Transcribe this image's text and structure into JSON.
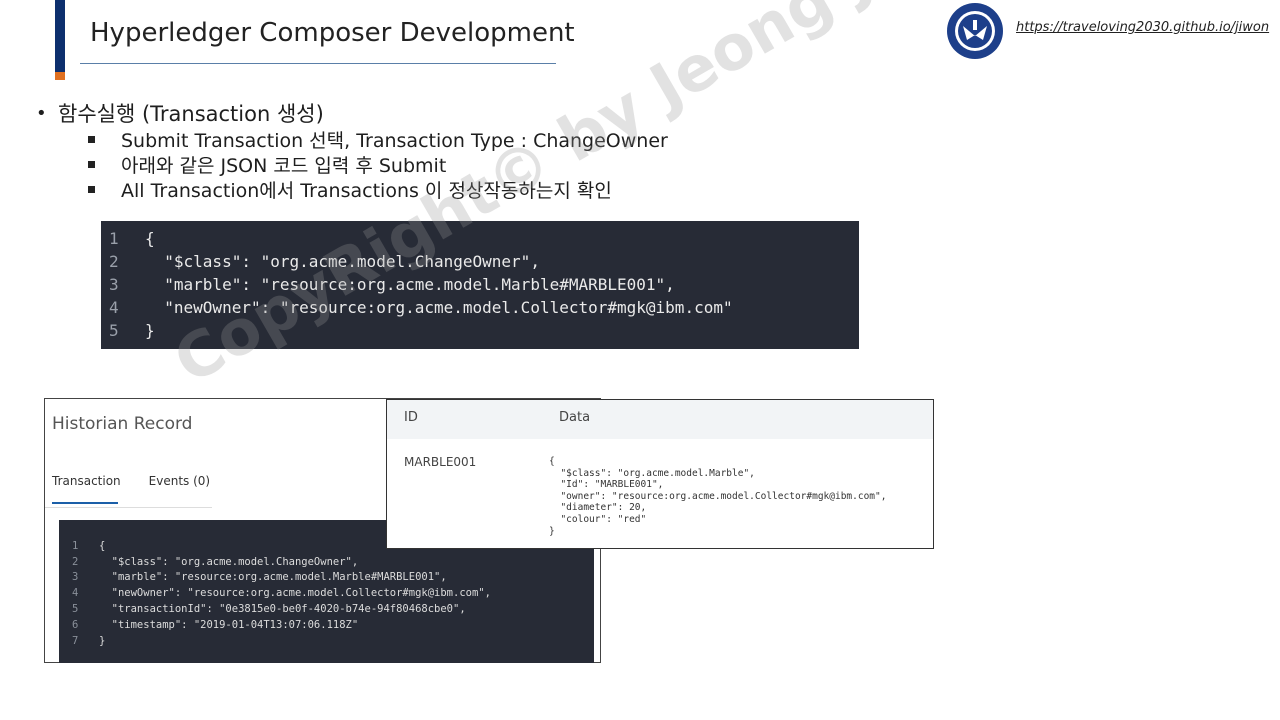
{
  "header": {
    "title": "Hyperledger Composer Development",
    "site_link": "https://traveloving2030.github.io/jiwon",
    "colors": {
      "accent_blue": "#0d2f6e",
      "accent_orange": "#e07020"
    }
  },
  "content": {
    "main_bullet": "함수실행 (Transaction 생성)",
    "sub_bullets": [
      "Submit Transaction 선택, Transaction Type : ChangeOwner",
      "아래와 같은 JSON 코드 입력 후 Submit",
      "All Transaction에서 Transactions 이 정상작동하는지 확인"
    ],
    "code_block": [
      {
        "num": "1",
        "text": "{"
      },
      {
        "num": "2",
        "text": "  \"$class\": \"org.acme.model.ChangeOwner\","
      },
      {
        "num": "3",
        "text": "  \"marble\": \"resource:org.acme.model.Marble#MARBLE001\","
      },
      {
        "num": "4",
        "text": "  \"newOwner\": \"resource:org.acme.model.Collector#mgk@ibm.com\""
      },
      {
        "num": "5",
        "text": "}"
      }
    ]
  },
  "historian": {
    "title": "Historian Record",
    "tabs": [
      "Transaction",
      "Events (0)"
    ],
    "code": [
      {
        "num": "1",
        "text": "{"
      },
      {
        "num": "2",
        "text": "  \"$class\": \"org.acme.model.ChangeOwner\","
      },
      {
        "num": "3",
        "text": "  \"marble\": \"resource:org.acme.model.Marble#MARBLE001\","
      },
      {
        "num": "4",
        "text": "  \"newOwner\": \"resource:org.acme.model.Collector#mgk@ibm.com\","
      },
      {
        "num": "5",
        "text": "  \"transactionId\": \"0e3815e0-be0f-4020-b74e-94f80468cbe0\","
      },
      {
        "num": "6",
        "text": "  \"timestamp\": \"2019-01-04T13:07:06.118Z\""
      },
      {
        "num": "7",
        "text": "}"
      }
    ]
  },
  "asset_table": {
    "headers": {
      "id": "ID",
      "data": "Data"
    },
    "row_id": "MARBLE001",
    "row_data": "{\n  \"$class\": \"org.acme.model.Marble\",\n  \"Id\": \"MARBLE001\",\n  \"owner\": \"resource:org.acme.model.Collector#mgk@ibm.com\",\n  \"diameter\": 20,\n  \"colour\": \"red\"\n}"
  },
  "watermark": "CopyRight© by Jeong JiWon"
}
